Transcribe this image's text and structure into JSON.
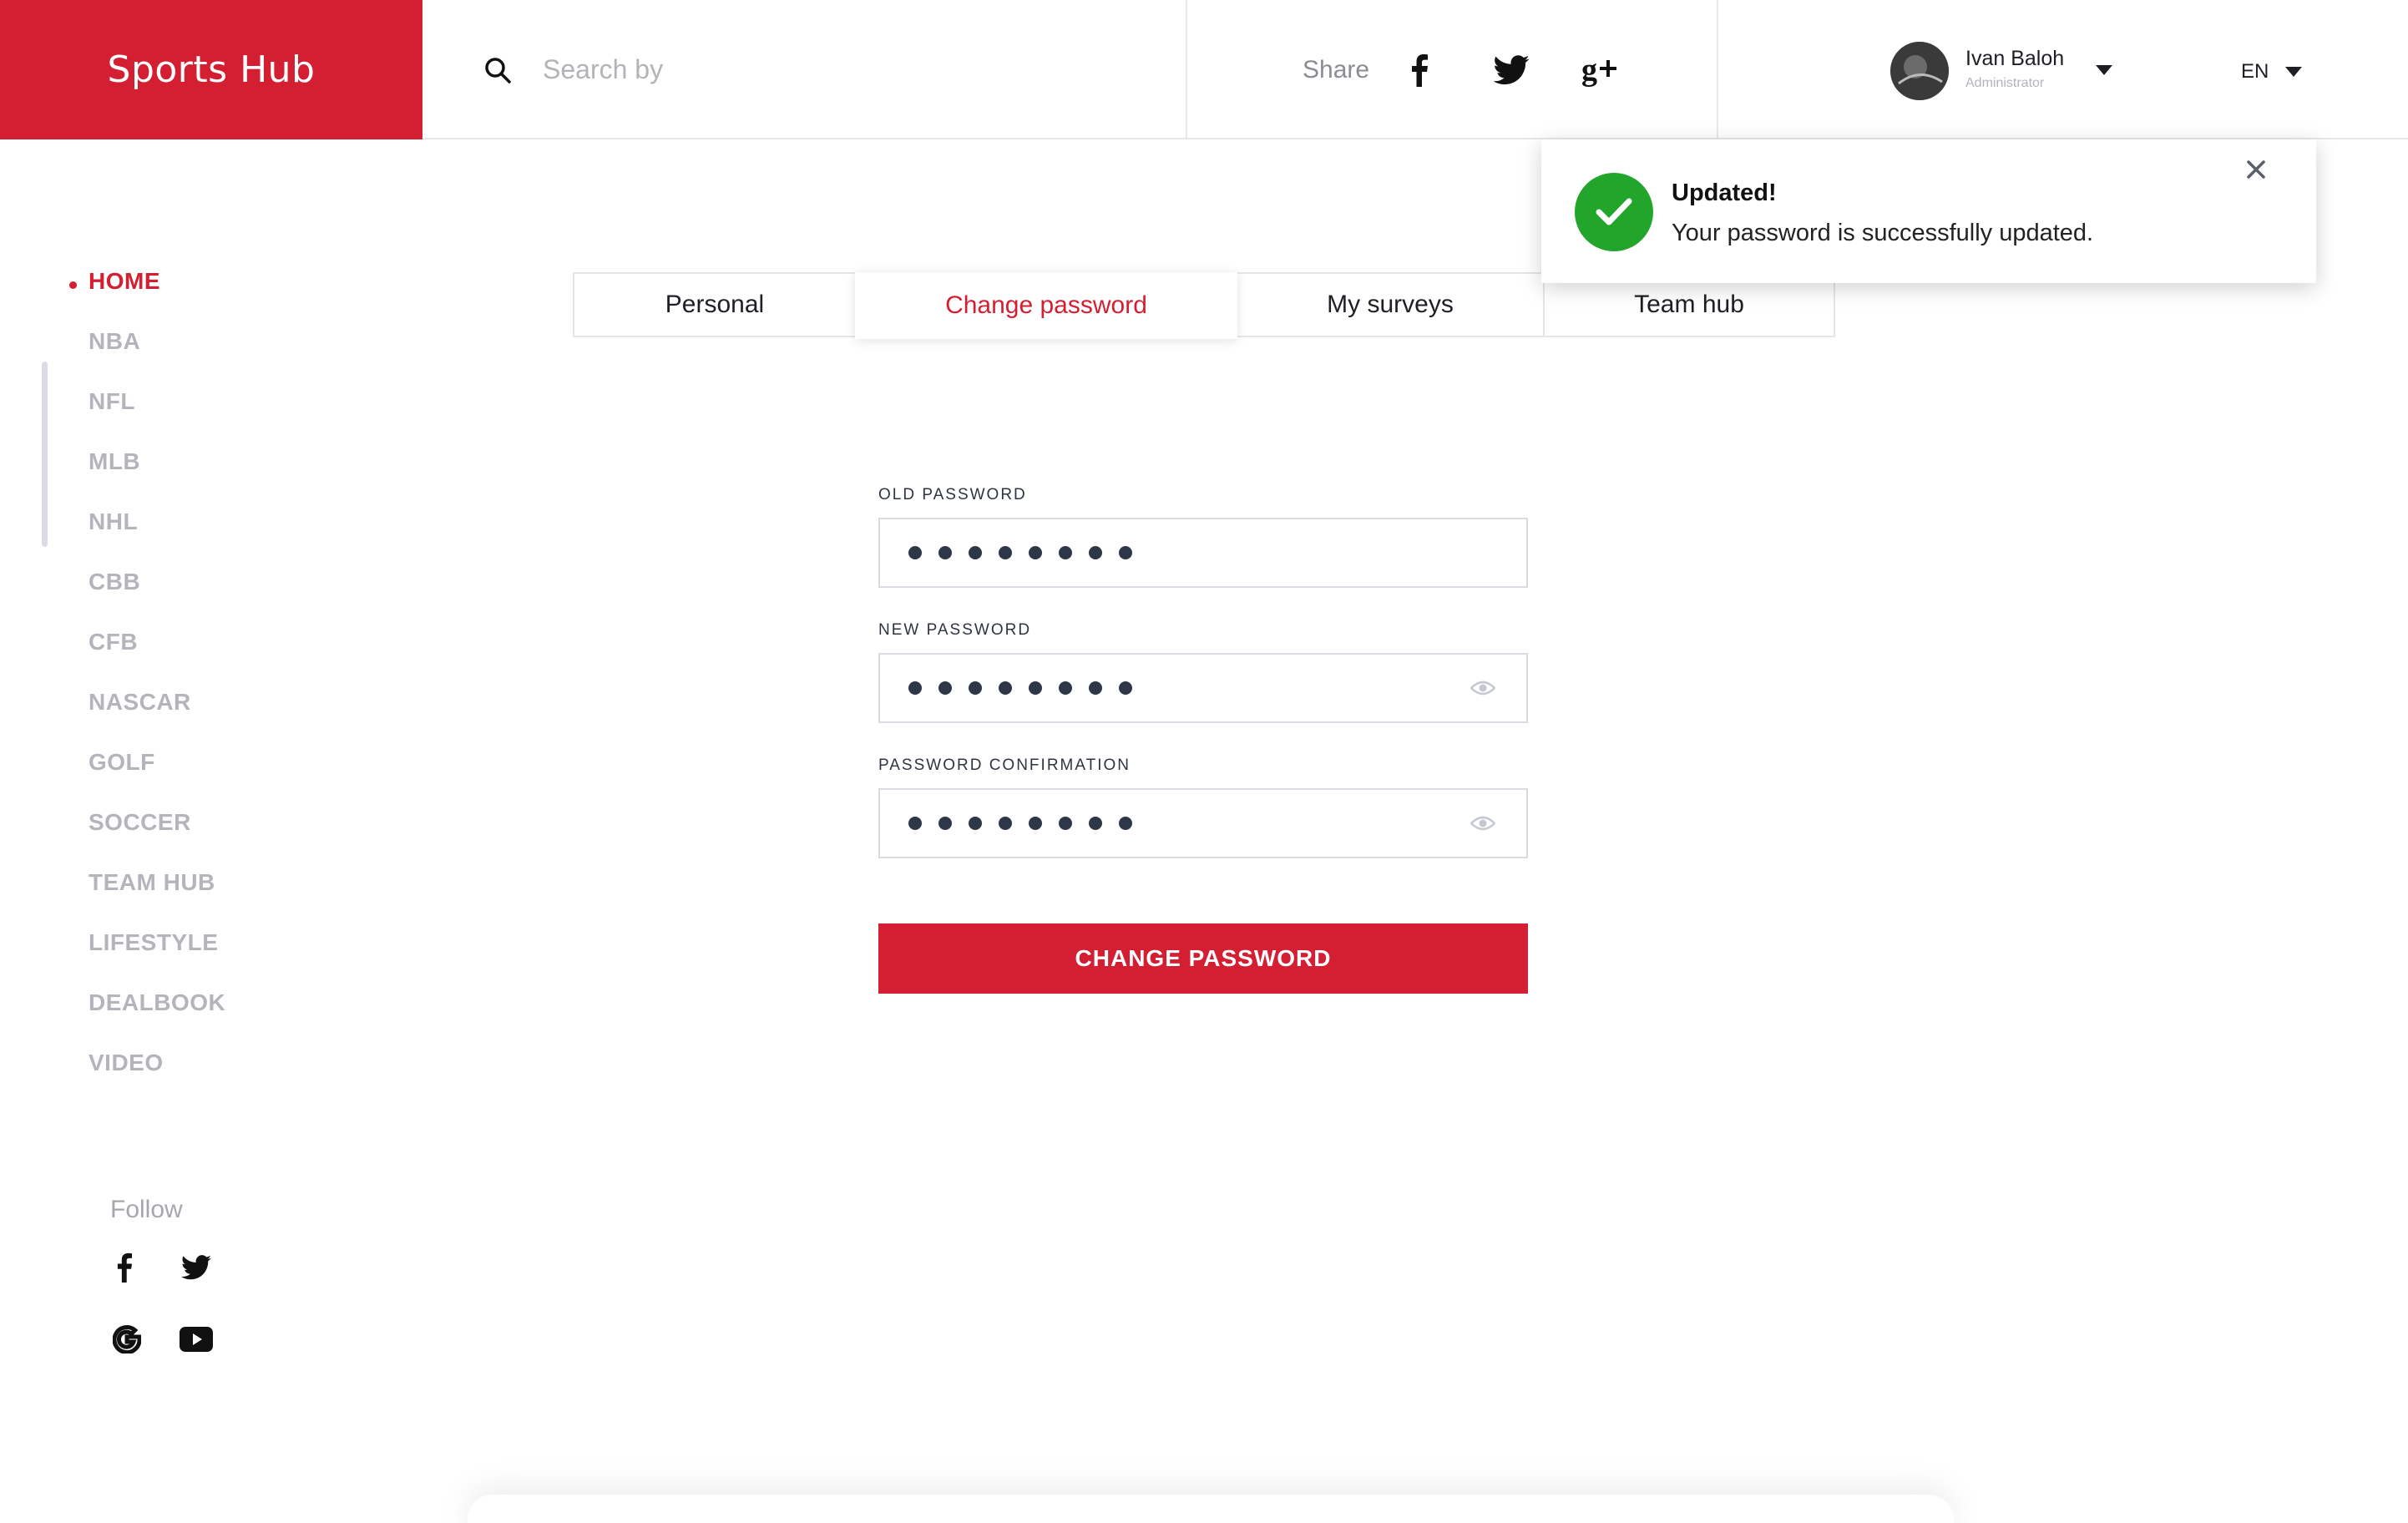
{
  "brand": {
    "name": "Sports Hub",
    "color": "#d41f32"
  },
  "search": {
    "placeholder": "Search by"
  },
  "share": {
    "label": "Share",
    "icons": [
      "facebook-icon",
      "twitter-icon",
      "google-plus-icon"
    ]
  },
  "user": {
    "name": "Ivan Baloh",
    "role": "Administrator"
  },
  "language": {
    "selected": "EN"
  },
  "sidebar": {
    "items": [
      {
        "label": "HOME",
        "active": true
      },
      {
        "label": "NBA"
      },
      {
        "label": "NFL"
      },
      {
        "label": "MLB"
      },
      {
        "label": "NHL"
      },
      {
        "label": "CBB"
      },
      {
        "label": "CFB"
      },
      {
        "label": "NASCAR"
      },
      {
        "label": "GOLF"
      },
      {
        "label": "SOCCER"
      },
      {
        "label": "TEAM HUB"
      },
      {
        "label": "LIFESTYLE"
      },
      {
        "label": "DEALBOOK"
      },
      {
        "label": "VIDEO"
      }
    ],
    "follow": {
      "label": "Follow",
      "icons": [
        "facebook-icon",
        "twitter-icon",
        "google-icon",
        "youtube-icon"
      ]
    }
  },
  "tabs": [
    {
      "label": "Personal"
    },
    {
      "label": "Change password",
      "active": true
    },
    {
      "label": "My surveys"
    },
    {
      "label": "Team hub"
    }
  ],
  "form": {
    "old_password": {
      "label": "OLD PASSWORD",
      "masked_length": 8
    },
    "new_password": {
      "label": "NEW PASSWORD",
      "masked_length": 8
    },
    "confirm_password": {
      "label": "PASSWORD CONFIRMATION",
      "masked_length": 8
    },
    "submit_label": "CHANGE PASSWORD"
  },
  "toast": {
    "title": "Updated!",
    "message": "Your password is successfully updated.",
    "status_color": "#22a52b"
  }
}
